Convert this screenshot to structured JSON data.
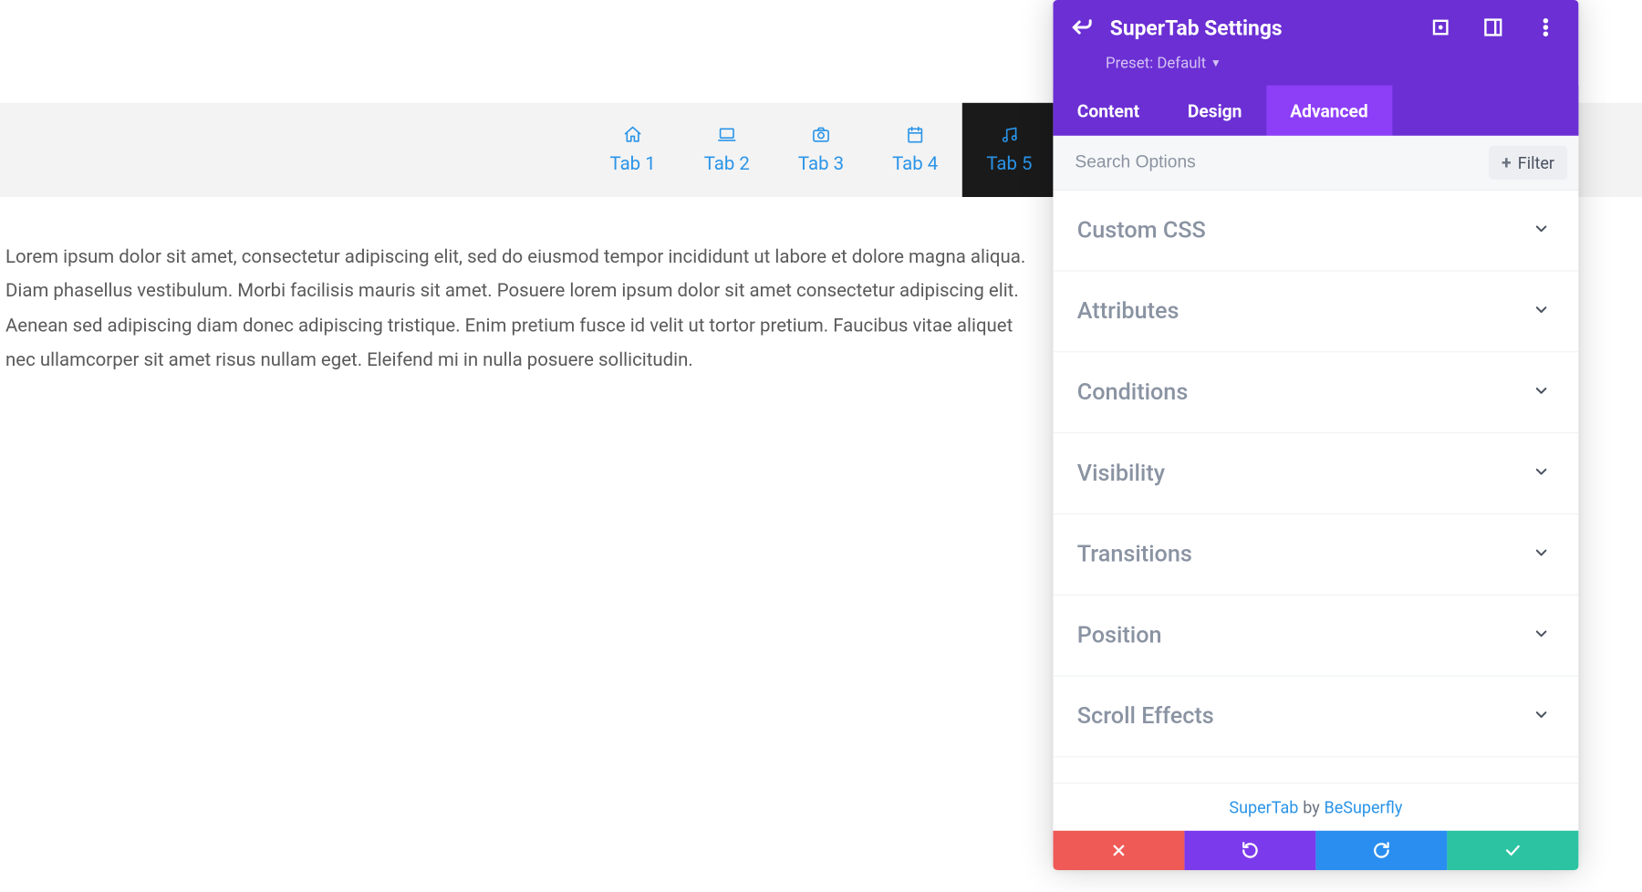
{
  "page": {
    "tabs": [
      {
        "label": "Tab 1",
        "icon": "home-icon",
        "active": false
      },
      {
        "label": "Tab 2",
        "icon": "laptop-icon",
        "active": false
      },
      {
        "label": "Tab 3",
        "icon": "camera-icon",
        "active": false
      },
      {
        "label": "Tab 4",
        "icon": "calendar-icon",
        "active": false
      },
      {
        "label": "Tab 5",
        "icon": "music-icon",
        "active": true
      }
    ],
    "lorem": "Lorem ipsum dolor sit amet, consectetur adipiscing elit, sed do eiusmod tempor incididunt ut labore et dolore magna aliqua. Diam phasellus vestibulum. Morbi facilisis mauris sit amet. Posuere lorem ipsum dolor sit amet consectetur adipiscing elit. Aenean sed adipiscing diam donec adipiscing tristique. Enim pretium fusce id velit ut tortor pretium. Faucibus vitae aliquet nec ullamcorper sit amet risus nullam eget. Eleifend mi in nulla posuere sollicitudin."
  },
  "panel": {
    "title": "SuperTab Settings",
    "preset_label": "Preset: Default",
    "tabs": {
      "content": "Content",
      "design": "Design",
      "advanced": "Advanced"
    },
    "active_tab": "advanced",
    "search_placeholder": "Search Options",
    "filter_label": "Filter",
    "sections": [
      "Custom CSS",
      "Attributes",
      "Conditions",
      "Visibility",
      "Transitions",
      "Position",
      "Scroll Effects"
    ],
    "credit": {
      "product": "SuperTab",
      "by": "by",
      "author": "BeSuperfly"
    }
  }
}
